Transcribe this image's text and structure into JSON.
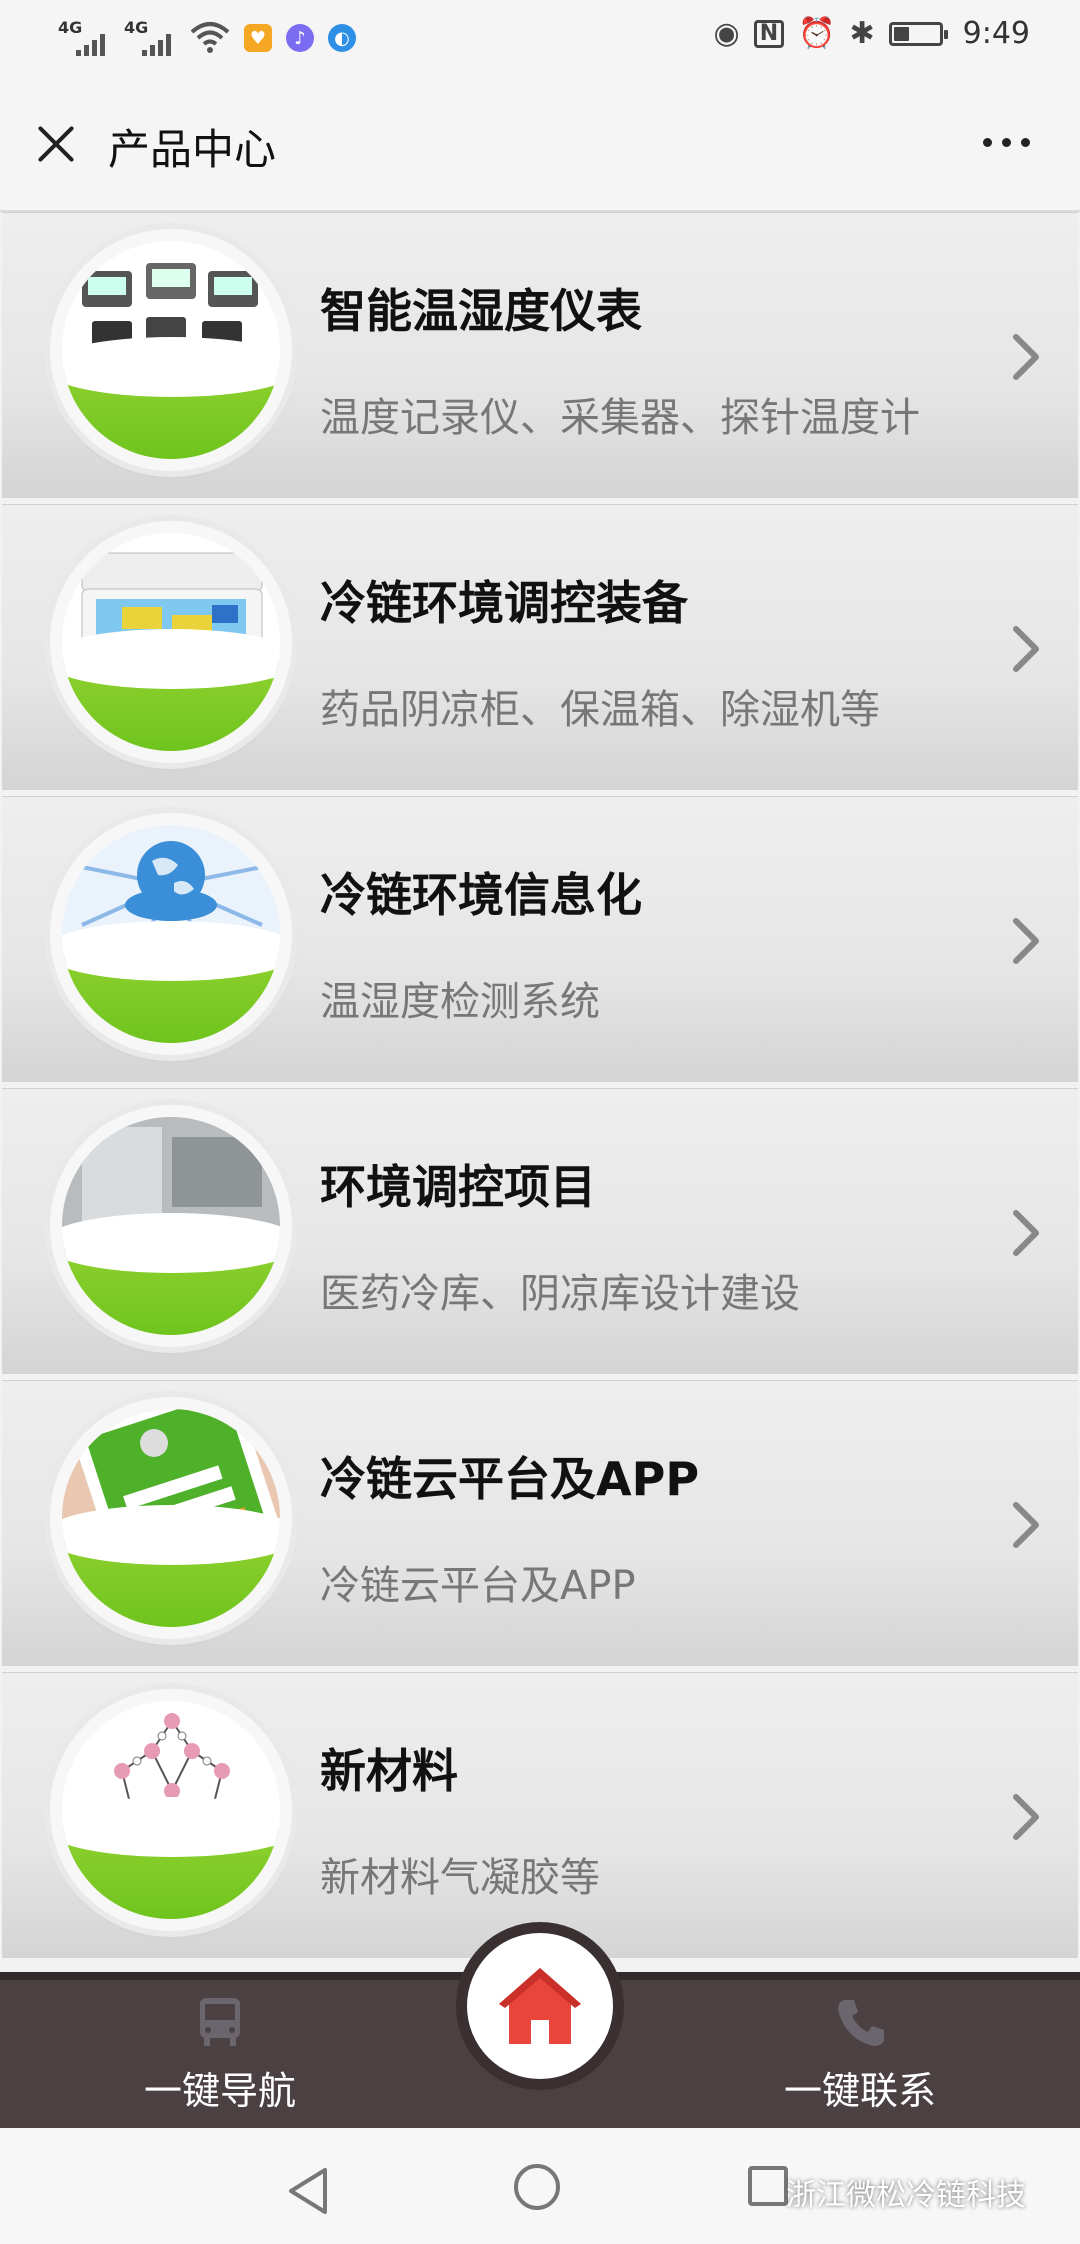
{
  "status_bar": {
    "signal1": "4G",
    "signal2": "4G",
    "time": "9:49",
    "battery_level": 0.35
  },
  "header": {
    "title": "产品中心"
  },
  "products": [
    {
      "title": "智能温湿度仪表",
      "subtitle": "温度记录仪、采集器、探针温度计",
      "image_icon": "temperature-meters-icon"
    },
    {
      "title": "冷链环境调控装备",
      "subtitle": "药品阴凉柜、保温箱、除湿机等",
      "image_icon": "cooler-box-icon"
    },
    {
      "title": "冷链环境信息化",
      "subtitle": "温湿度检测系统",
      "image_icon": "globe-network-icon"
    },
    {
      "title": "环境调控项目",
      "subtitle": "医药冷库、阴凉库设计建设",
      "image_icon": "cold-room-icon"
    },
    {
      "title": "冷链云平台及APP",
      "subtitle": "冷链云平台及APP",
      "image_icon": "phone-app-icon"
    },
    {
      "title": "新材料",
      "subtitle": "新材料气凝胶等",
      "image_icon": "molecule-icon"
    }
  ],
  "bottom_bar": {
    "navigate_label": "一键导航",
    "contact_label": "一键联系"
  },
  "watermark": "浙江微松冷链科技",
  "colors": {
    "green": "#7ac626",
    "bottom_bar": "#4c4142",
    "home_red": "#e8453c"
  }
}
